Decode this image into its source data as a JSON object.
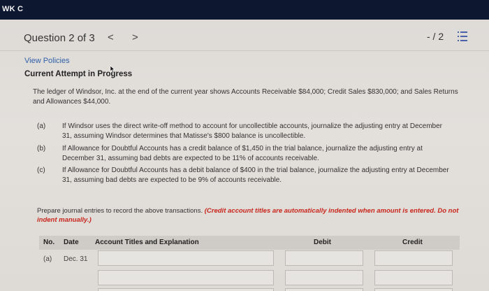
{
  "topbar": {
    "brand": "WK C"
  },
  "header": {
    "question_label": "Question 2 of 3",
    "prev_glyph": "<",
    "next_glyph": ">",
    "score": "- / 2",
    "list_icon": "list-icon"
  },
  "links": {
    "view_policies": "View Policies"
  },
  "attempt": {
    "label": "Current Attempt in Progress"
  },
  "problem": {
    "intro": "The ledger of Windsor, Inc. at the end of the current year shows Accounts Receivable $84,000; Credit Sales $830,000; and Sales Returns and Allowances $44,000.",
    "parts": [
      {
        "label": "(a)",
        "text": "If Windsor uses the direct write-off method to account for uncollectible accounts, journalize the adjusting entry at December 31, assuming Windsor determines that Matisse's $800 balance is uncollectible."
      },
      {
        "label": "(b)",
        "text": "If Allowance for Doubtful Accounts has a credit balance of $1,450 in the trial balance, journalize the adjusting entry at December 31, assuming bad debts are expected to be 11% of accounts receivable."
      },
      {
        "label": "(c)",
        "text": "If Allowance for Doubtful Accounts has a debit balance of $400 in the trial balance, journalize the adjusting entry at December 31, assuming bad debts are expected to be 9% of accounts receivable."
      }
    ]
  },
  "instructions": {
    "main": "Prepare journal entries to record the above transactions. ",
    "note": "(Credit account titles are automatically indented when amount is entered. Do not indent manually.)"
  },
  "journal": {
    "headers": {
      "no": "No.",
      "date": "Date",
      "account": "Account Titles and Explanation",
      "debit": "Debit",
      "credit": "Credit"
    },
    "rows": [
      {
        "no": "(a)",
        "date": "Dec. 31"
      }
    ]
  }
}
